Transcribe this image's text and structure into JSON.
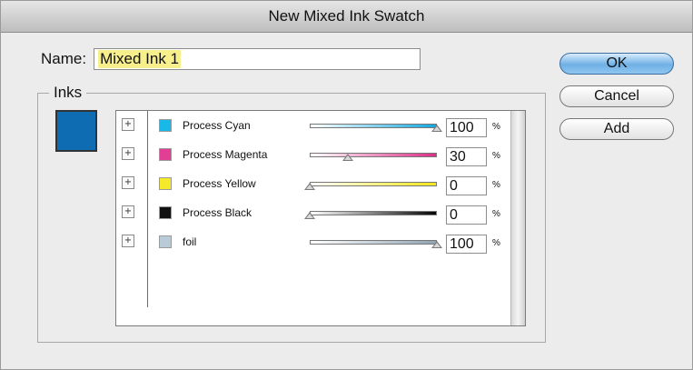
{
  "window": {
    "title": "New Mixed Ink Swatch"
  },
  "name": {
    "label": "Name:",
    "value": "Mixed Ink 1"
  },
  "inks": {
    "label": "Inks",
    "preview_color": "#0e6cb3",
    "percent_unit": "%",
    "items": [
      {
        "name": "Process Cyan",
        "color": "#18b8e8",
        "percent": "100",
        "value": 100,
        "track": "linear-gradient(90deg,#ffffff,#13a8e0)"
      },
      {
        "name": "Process Magenta",
        "color": "#e23e93",
        "percent": "30",
        "value": 30,
        "track": "linear-gradient(90deg,#ffffff,#dd2e88)"
      },
      {
        "name": "Process Yellow",
        "color": "#f4ea2a",
        "percent": "0",
        "value": 0,
        "track": "linear-gradient(90deg,#ffffff,#f3e71a)"
      },
      {
        "name": "Process Black",
        "color": "#111111",
        "percent": "0",
        "value": 0,
        "track": "linear-gradient(90deg,#ffffff,#050505)"
      },
      {
        "name": "foil",
        "color": "#b9cbd6",
        "percent": "100",
        "value": 100,
        "track": "linear-gradient(90deg,#ffffff,#8fa4b4)"
      }
    ]
  },
  "buttons": {
    "ok": "OK",
    "cancel": "Cancel",
    "add": "Add"
  }
}
